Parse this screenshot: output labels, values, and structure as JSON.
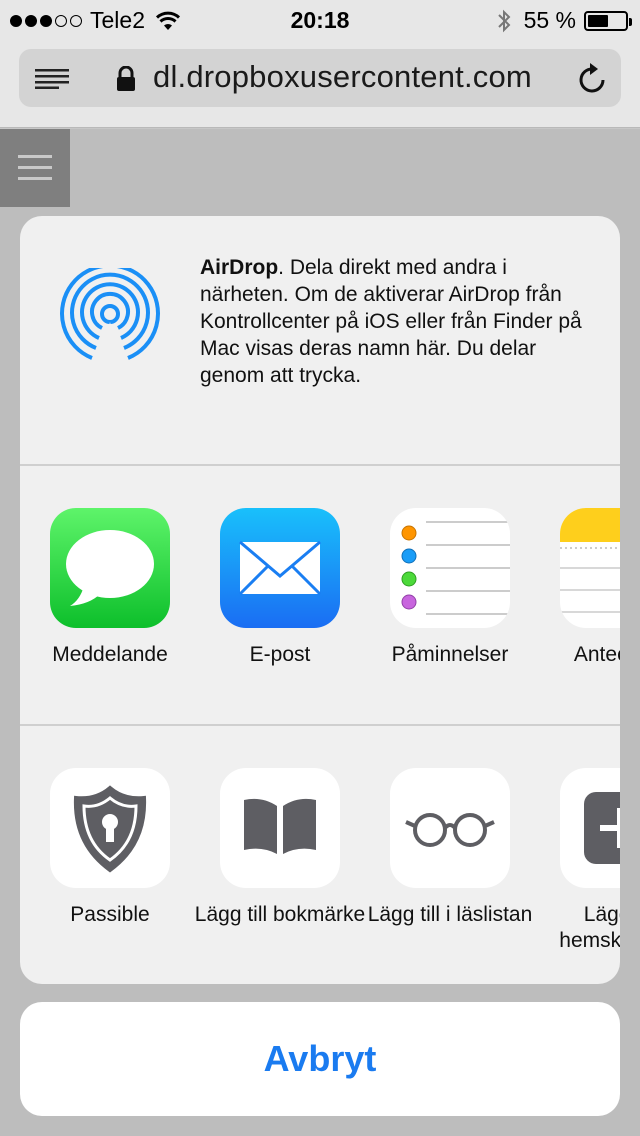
{
  "status_bar": {
    "carrier": "Tele2",
    "signal_bars_filled": 3,
    "signal_bars_total": 5,
    "time": "20:18",
    "battery_percent": "55 %",
    "battery_level": 0.55
  },
  "browser": {
    "url": "dl.dropboxusercontent.com"
  },
  "share_sheet": {
    "airdrop": {
      "title": "AirDrop",
      "description": ". Dela direkt med andra i närheten. Om de aktiverar AirDrop från Kontrollcenter på iOS eller från Finder på Mac visas deras namn här. Du delar genom att trycka."
    },
    "apps": [
      {
        "label": "Meddelande",
        "icon": "messages-icon"
      },
      {
        "label": "E-post",
        "icon": "mail-icon"
      },
      {
        "label": "Påminnelser",
        "icon": "reminders-icon"
      },
      {
        "label": "Antecknin",
        "icon": "notes-icon"
      }
    ],
    "actions": [
      {
        "label": "Passible",
        "icon": "passible-shield-icon"
      },
      {
        "label": "Lägg till bokmärke",
        "icon": "book-icon"
      },
      {
        "label": "Lägg till i läslistan",
        "icon": "glasses-icon"
      },
      {
        "label": "Lägg till hemskärmen",
        "icon": "add-to-homescreen-icon"
      }
    ],
    "cancel_label": "Avbryt"
  },
  "colors": {
    "accent": "#1a7bf0",
    "messages_green": "#1fd13a",
    "mail_blue": "#1a8ff6",
    "notes_yellow": "#fecf1c"
  }
}
